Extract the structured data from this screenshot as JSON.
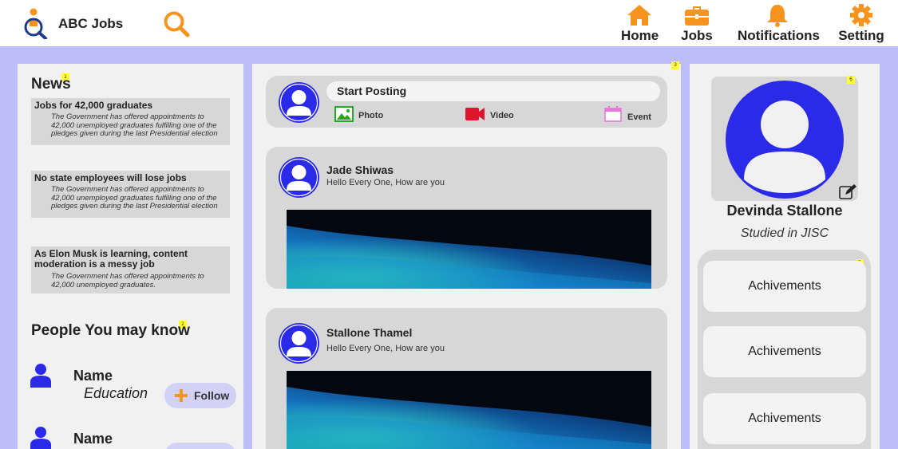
{
  "header": {
    "brand": "ABC Jobs",
    "nav": [
      {
        "label": "Home",
        "icon": "home-icon"
      },
      {
        "label": "Jobs",
        "icon": "briefcase-icon"
      },
      {
        "label": "Notifications",
        "icon": "bell-icon"
      },
      {
        "label": "Setting",
        "icon": "gear-icon"
      }
    ],
    "accent_color": "#f7941d"
  },
  "markers": [
    "1",
    "2",
    "3",
    "4",
    "5",
    "6"
  ],
  "news": {
    "title": "News",
    "items": [
      {
        "headline": "Jobs for 42,000 graduates",
        "body": "The Government has offered appointments to 42,000 unemployed graduates fulfilling one of the pledges given during the last Presidential election"
      },
      {
        "headline": "No state employees will lose jobs",
        "body": "The Government has offered appointments to 42,000 unemployed graduates fulfilling one of the pledges given during the last Presidential election"
      },
      {
        "headline": "As Elon Musk is learning, content moderation is a messy job",
        "body": "The Government has offered appointments to 42,000 unemployed graduates."
      }
    ]
  },
  "people": {
    "title": "People You may know",
    "items": [
      {
        "name": "Name",
        "education": "Education",
        "follow_label": "Follow"
      },
      {
        "name": "Name",
        "education": "",
        "follow_label": ""
      }
    ]
  },
  "composer": {
    "placeholder": "Start Posting",
    "actions": [
      {
        "label": "Photo",
        "icon": "photo-icon"
      },
      {
        "label": "Video",
        "icon": "video-camera-icon"
      },
      {
        "label": "Event",
        "icon": "calendar-icon"
      }
    ]
  },
  "posts": [
    {
      "author": "Jade Shiwas",
      "text": "Hello Every One, How are you"
    },
    {
      "author": "Stallone Thamel",
      "text": "Hello Every One, How are you"
    }
  ],
  "profile": {
    "name": "Devinda Stallone",
    "studies": "Studied in JISC",
    "achievements": [
      "Achivements",
      "Achivements",
      "Achivements"
    ]
  },
  "colors": {
    "background": "#bdbdf9",
    "avatar_blue": "#2a2ae8",
    "panel": "#f1f1f1",
    "card": "#d7d7d7"
  }
}
